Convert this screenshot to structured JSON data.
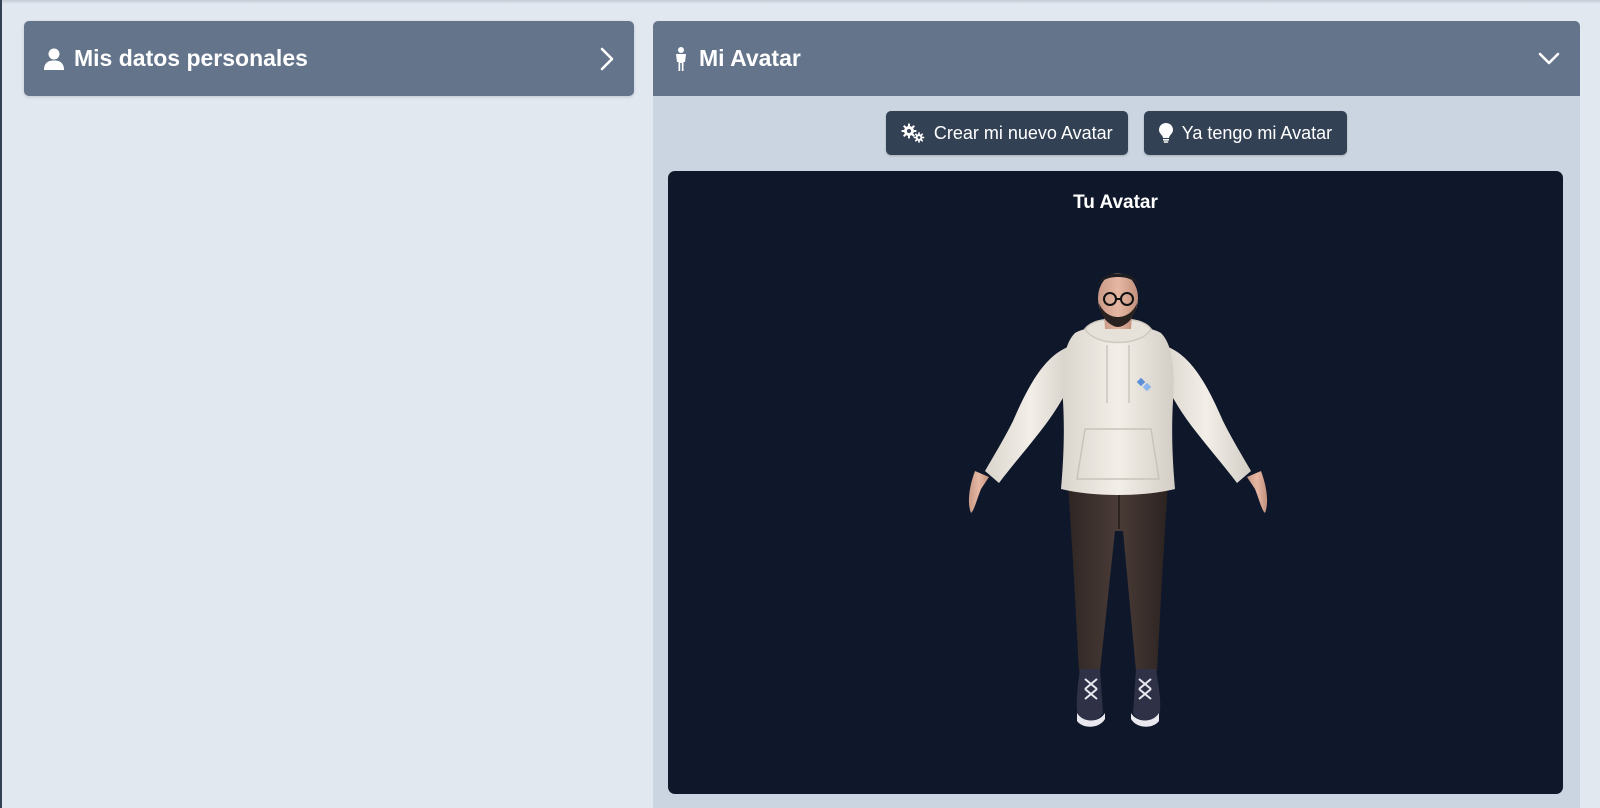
{
  "left_section": {
    "title": "Mis datos personales",
    "icon": "user-icon",
    "toggle_icon": "chevron-right-icon"
  },
  "right_section": {
    "title": "Mi Avatar",
    "icon": "person-standing-icon",
    "toggle_icon": "chevron-down-icon",
    "buttons": {
      "create": {
        "label": "Crear mi nuevo Avatar",
        "icon": "gears-icon"
      },
      "existing": {
        "label": "Ya tengo mi Avatar",
        "icon": "lightbulb-icon"
      }
    },
    "viewer": {
      "title": "Tu Avatar"
    }
  },
  "colors": {
    "page_background": "#e2e8f0",
    "header": "#64748b",
    "panel": "#cbd5e1",
    "button": "#334155",
    "viewer_background": "#0f172a"
  }
}
